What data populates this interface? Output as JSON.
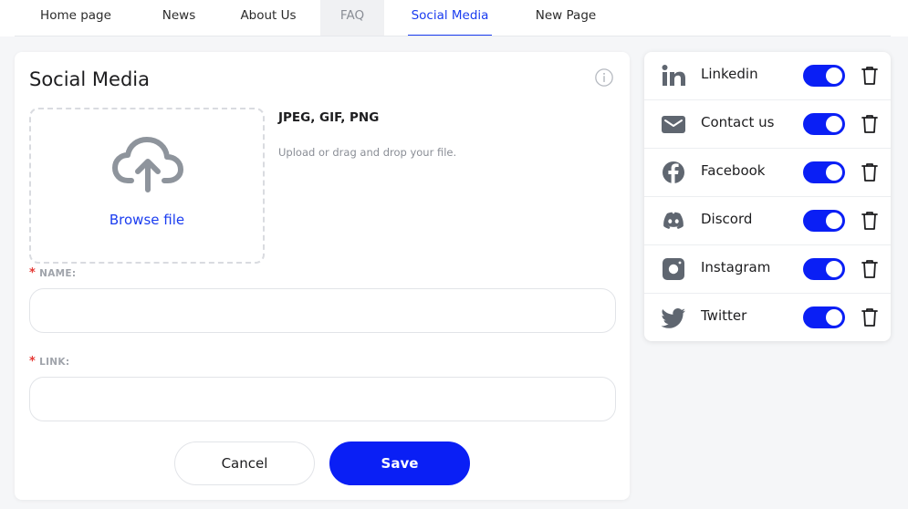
{
  "tabs": [
    {
      "label": "Home page"
    },
    {
      "label": "News"
    },
    {
      "label": "About Us"
    },
    {
      "label": "FAQ"
    },
    {
      "label": "Social Media"
    },
    {
      "label": "New Page"
    }
  ],
  "active_tab": "Social Media",
  "form": {
    "title": "Social Media",
    "upload": {
      "browse_label": "Browse file",
      "formats": "JPEG, GIF, PNG",
      "hint": "Upload or drag and drop your file."
    },
    "name_field": {
      "required_mark": "*",
      "label": "NAME:",
      "value": "",
      "placeholder": ""
    },
    "link_field": {
      "required_mark": "*",
      "label": "LINK:",
      "value": "",
      "placeholder": ""
    },
    "cancel_label": "Cancel",
    "save_label": "Save"
  },
  "social_links": [
    {
      "label": "Linkedin",
      "icon": "linkedin-icon",
      "enabled": true
    },
    {
      "label": "Contact us",
      "icon": "mail-icon",
      "enabled": true
    },
    {
      "label": "Facebook",
      "icon": "facebook-icon",
      "enabled": true
    },
    {
      "label": "Discord",
      "icon": "discord-icon",
      "enabled": true
    },
    {
      "label": "Instagram",
      "icon": "instagram-icon",
      "enabled": true
    },
    {
      "label": "Twitter",
      "icon": "twitter-icon",
      "enabled": true
    }
  ],
  "colors": {
    "accent": "#0a1ff5",
    "active_tab": "#1a3cf0",
    "required": "#e53935",
    "icon_gray": "#5f6670"
  }
}
